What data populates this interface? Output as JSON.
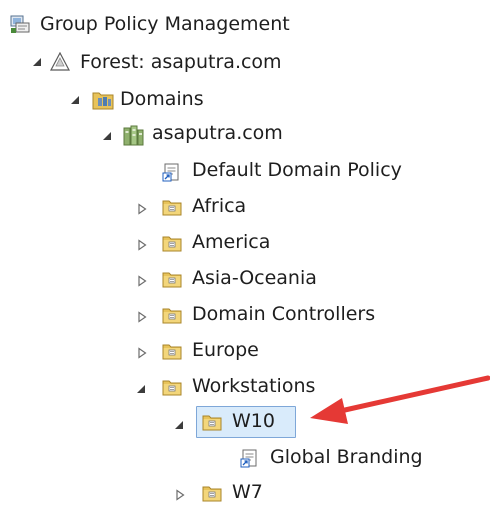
{
  "tree": {
    "root": {
      "label": "Group Policy Management",
      "icon": "gpm-console-icon"
    },
    "forest": {
      "label": "Forest: asaputra.com",
      "icon": "forest-icon",
      "expanded": true
    },
    "domains": {
      "label": "Domains",
      "icon": "domains-folder-icon",
      "expanded": true
    },
    "domain": {
      "label": "asaputra.com",
      "icon": "domain-icon",
      "expanded": true
    },
    "items": [
      {
        "label": "Default Domain Policy",
        "type": "gpo-link"
      },
      {
        "label": "Africa",
        "type": "ou",
        "expanded": false
      },
      {
        "label": "America",
        "type": "ou",
        "expanded": false
      },
      {
        "label": "Asia-Oceania",
        "type": "ou",
        "expanded": false
      },
      {
        "label": "Domain Controllers",
        "type": "ou",
        "expanded": false
      },
      {
        "label": "Europe",
        "type": "ou",
        "expanded": false
      },
      {
        "label": "Workstations",
        "type": "ou",
        "expanded": true
      }
    ],
    "workstations_children": [
      {
        "label": "W10",
        "type": "ou",
        "expanded": true,
        "selected": true
      },
      {
        "label": "Global Branding",
        "type": "gpo-link"
      },
      {
        "label": "W7",
        "type": "ou",
        "expanded": false
      }
    ]
  },
  "annotation": {
    "arrow_color": "#e53935",
    "points_to": "W10"
  },
  "colors": {
    "selection_bg": "#d9ebfb",
    "selection_border": "#7ea7d8",
    "folder": "#e8c35a"
  }
}
